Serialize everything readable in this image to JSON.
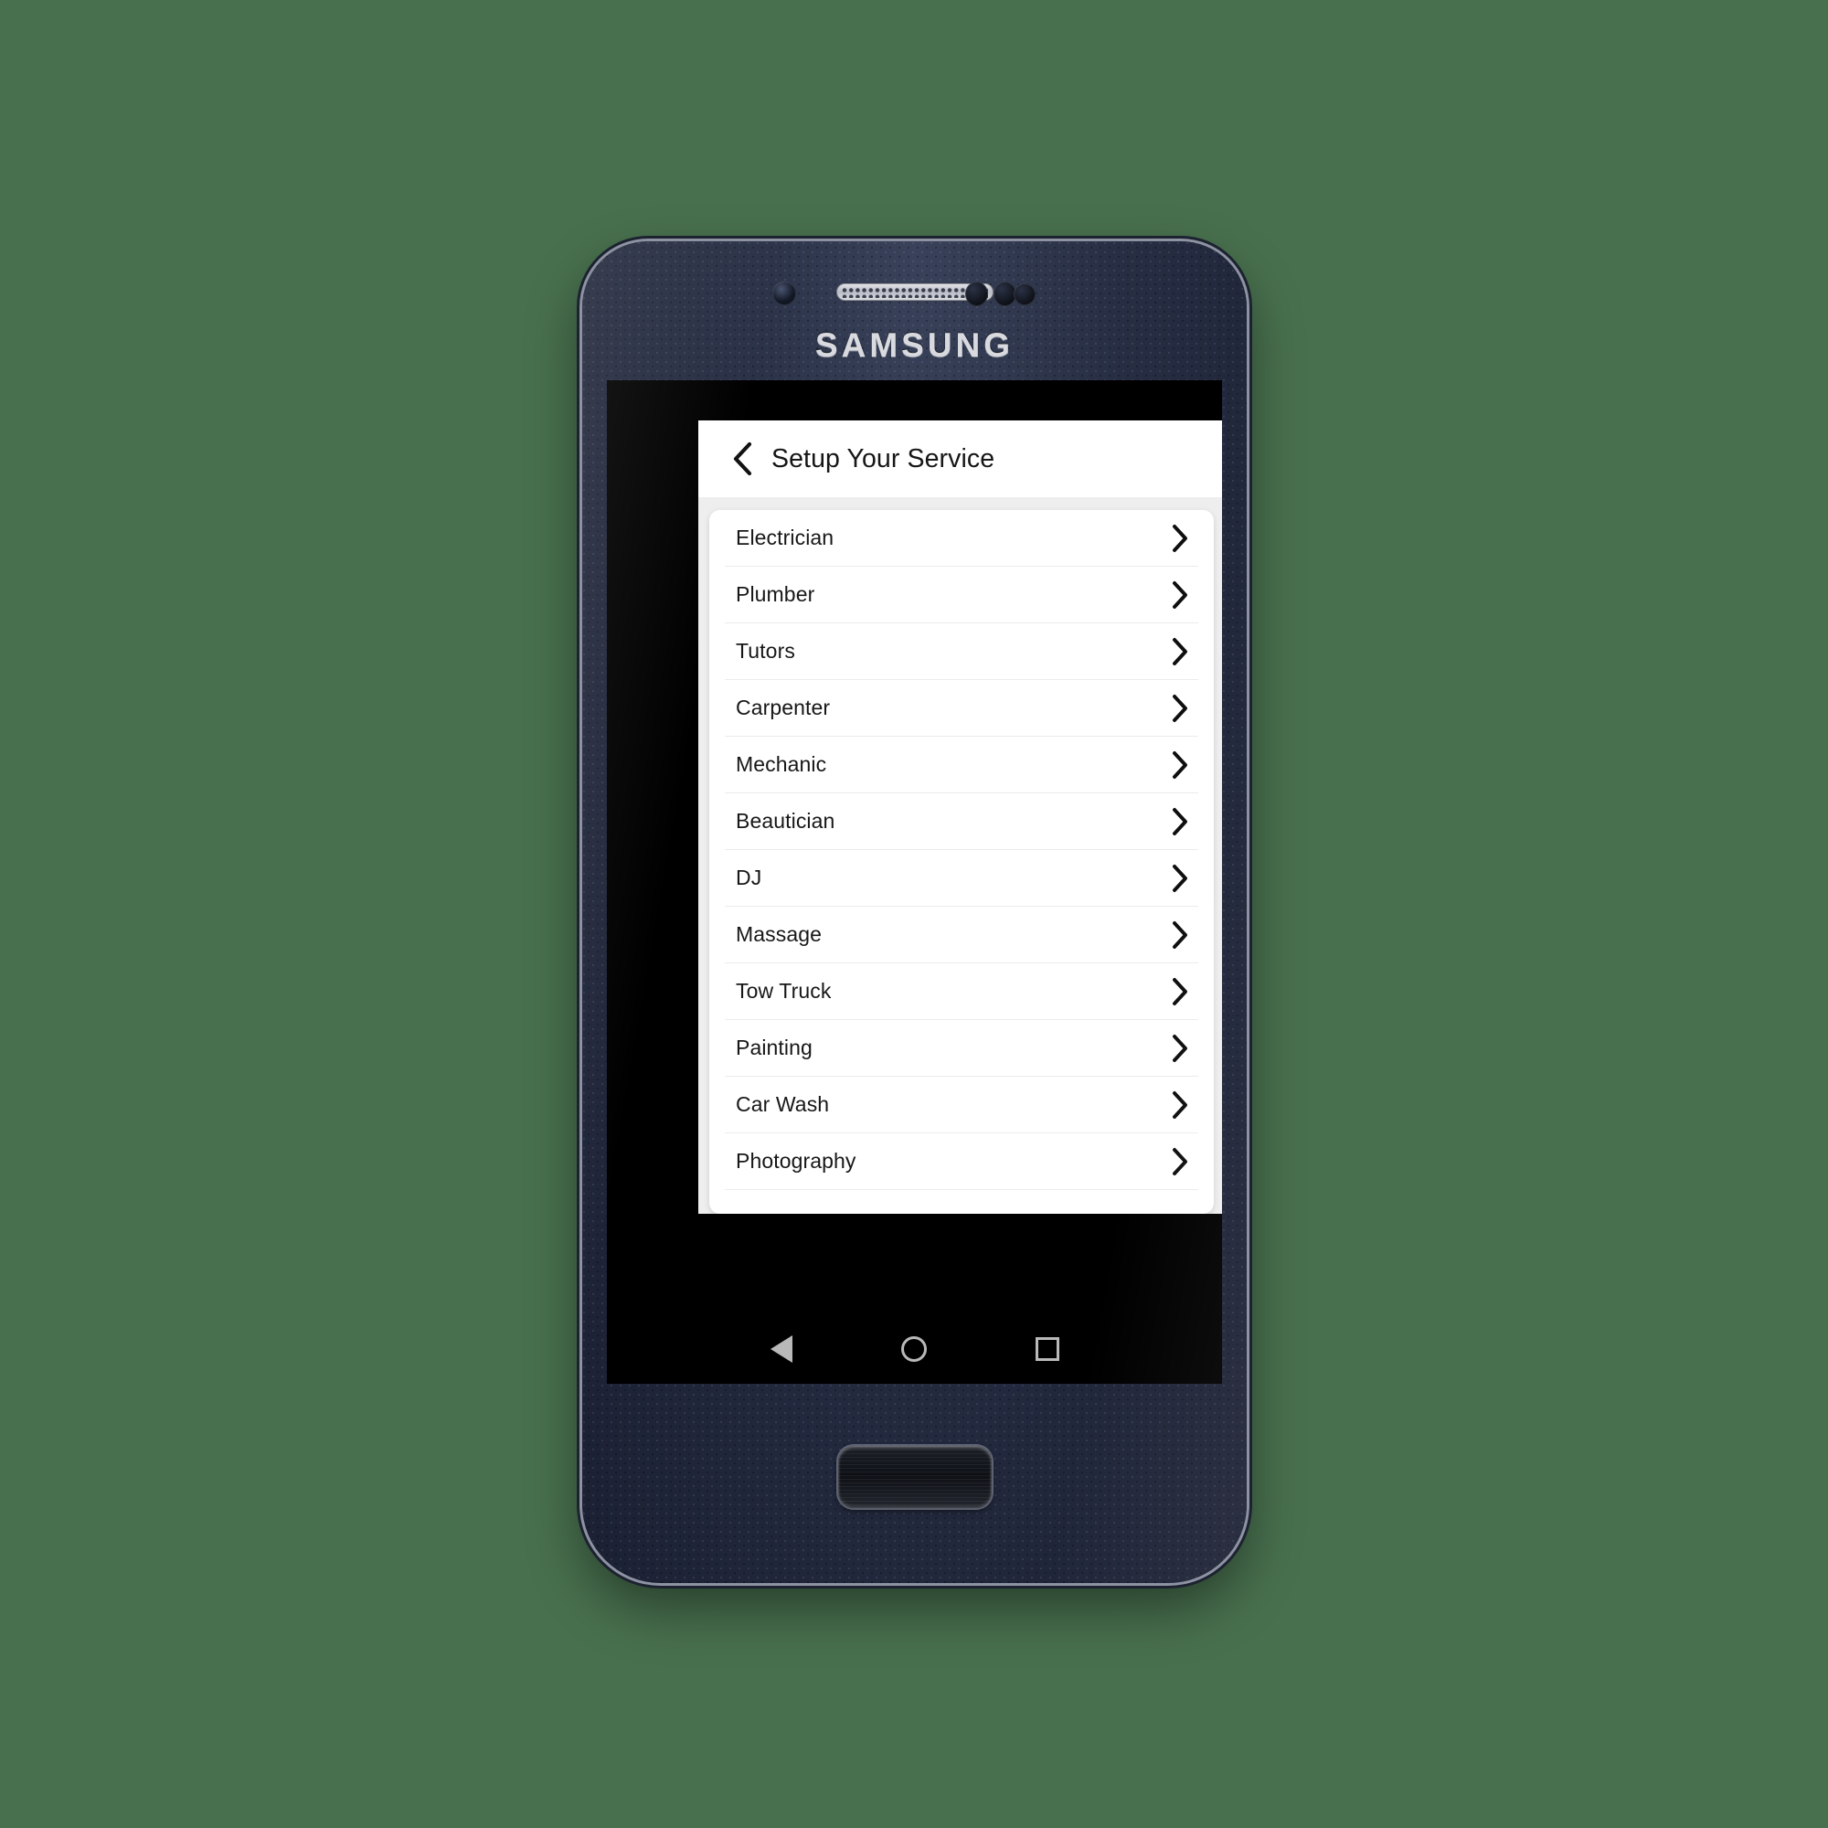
{
  "canvas": {
    "background_color": "#48704e"
  },
  "device": {
    "brand": "SAMSUNG",
    "hardware": {
      "earpiece": "earpiece-speaker",
      "front_camera": "front-camera",
      "proximity_sensor": "proximity-sensor",
      "home_button": "home-button"
    }
  },
  "app": {
    "header": {
      "back_icon": "chevron-left-icon",
      "title": "Setup Your Service"
    },
    "colors": {
      "page_background": "#eeeeee",
      "card_background": "#ffffff",
      "text": "#171717",
      "divider": "#ececec"
    },
    "services": [
      {
        "label": "Electrician",
        "chevron": "chevron-right-icon"
      },
      {
        "label": "Plumber",
        "chevron": "chevron-right-icon"
      },
      {
        "label": "Tutors",
        "chevron": "chevron-right-icon"
      },
      {
        "label": "Carpenter",
        "chevron": "chevron-right-icon"
      },
      {
        "label": "Mechanic",
        "chevron": "chevron-right-icon"
      },
      {
        "label": "Beautician",
        "chevron": "chevron-right-icon"
      },
      {
        "label": "DJ",
        "chevron": "chevron-right-icon"
      },
      {
        "label": "Massage",
        "chevron": "chevron-right-icon"
      },
      {
        "label": "Tow Truck",
        "chevron": "chevron-right-icon"
      },
      {
        "label": "Painting",
        "chevron": "chevron-right-icon"
      },
      {
        "label": "Car Wash",
        "chevron": "chevron-right-icon"
      },
      {
        "label": "Photography",
        "chevron": "chevron-right-icon"
      }
    ]
  },
  "navbar": {
    "back": "back-triangle-icon",
    "home": "home-circle-icon",
    "recents": "recents-square-icon"
  }
}
